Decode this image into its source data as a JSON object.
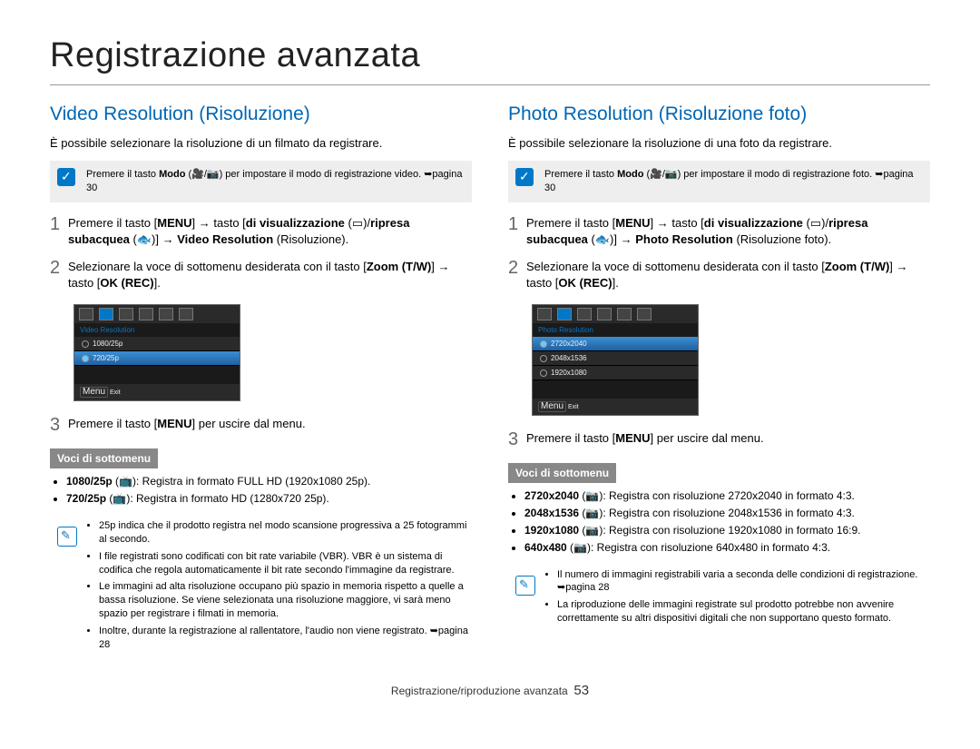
{
  "page": {
    "title": "Registrazione avanzata",
    "footer_text": "Registrazione/riproduzione avanzata",
    "page_number": "53"
  },
  "left": {
    "heading": "Video Resolution (Risoluzione)",
    "lead": "È possibile selezionare la risoluzione di un filmato da registrare.",
    "note_before": "Premere il tasto ",
    "note_bold": "Modo",
    "note_after": " (🎥/📷) per impostare il modo di registrazione video. ➥pagina 30",
    "step1_a": "Premere il tasto [",
    "step1_menu": "MENU",
    "step1_b": "] → tasto [",
    "step1_disp": "di visualizzazione",
    "step1_c": " (▭)/",
    "step1_d": "ripresa subacquea",
    "step1_e": " (🐟)] → ",
    "step1_res": "Video Resolution",
    "step1_f": " (Risoluzione).",
    "step2_a": "Selezionare la voce di sottomenu desiderata con il tasto [",
    "step2_zoom": "Zoom (T/W)",
    "step2_b": "] → tasto [",
    "step2_ok": "OK (REC)",
    "step2_c": "].",
    "step3_a": "Premere il tasto [",
    "step3_menu": "MENU",
    "step3_b": "] per uscire dal menu.",
    "screenshot": {
      "title": "Video Resolution",
      "items": [
        "1080/25p",
        "720/25p"
      ],
      "exit": "Exit"
    },
    "subhead": "Voci di sottomenu",
    "sub_items": [
      {
        "bold": "1080/25p",
        "text": " (📺): Registra in formato FULL HD (1920x1080 25p)."
      },
      {
        "bold": "720/25p",
        "text": " (📺): Registra in formato HD (1280x720 25p)."
      }
    ],
    "info": [
      "25p indica che il prodotto registra nel modo scansione progressiva a 25 fotogrammi al secondo.",
      "I file registrati sono codificati con bit rate variabile (VBR). VBR è un sistema di codifica che regola automaticamente il bit rate secondo l'immagine da registrare.",
      "Le immagini ad alta risoluzione occupano più spazio in memoria rispetto a quelle a bassa risoluzione. Se viene selezionata una risoluzione maggiore, vi sarà meno spazio per registrare i filmati in memoria.",
      "Inoltre, durante la registrazione al rallentatore, l'audio non viene registrato. ➥pagina 28"
    ]
  },
  "right": {
    "heading": "Photo Resolution (Risoluzione foto)",
    "lead": "È possibile selezionare la risoluzione di una foto da registrare.",
    "note_before": "Premere il tasto ",
    "note_bold": "Modo",
    "note_after": " (🎥/📷) per impostare il modo di registrazione foto. ➥pagina 30",
    "step1_a": "Premere il tasto [",
    "step1_menu": "MENU",
    "step1_b": "] → tasto [",
    "step1_disp": "di visualizzazione",
    "step1_c": " (▭)/",
    "step1_d": "ripresa subacquea",
    "step1_e": " (🐟)] → ",
    "step1_res": "Photo Resolution",
    "step1_f": " (Risoluzione foto).",
    "step2_a": "Selezionare la voce di sottomenu desiderata con il tasto [",
    "step2_zoom": "Zoom (T/W)",
    "step2_b": "] → tasto [",
    "step2_ok": "OK (REC)",
    "step2_c": "].",
    "step3_a": "Premere il tasto [",
    "step3_menu": "MENU",
    "step3_b": "] per uscire dal menu.",
    "screenshot": {
      "title": "Photo Resolution",
      "items": [
        "2720x2040",
        "2048x1536",
        "1920x1080"
      ],
      "exit": "Exit"
    },
    "subhead": "Voci di sottomenu",
    "sub_items": [
      {
        "bold": "2720x2040",
        "text": " (📷): Registra con risoluzione 2720x2040 in formato 4:3."
      },
      {
        "bold": "2048x1536",
        "text": " (📷): Registra con risoluzione 2048x1536 in formato 4:3."
      },
      {
        "bold": "1920x1080",
        "text": " (📷): Registra con risoluzione 1920x1080 in formato 16:9."
      },
      {
        "bold": "640x480",
        "text": " (📷): Registra con risoluzione 640x480 in formato 4:3."
      }
    ],
    "info": [
      "Il numero di immagini registrabili varia a seconda delle condizioni di registrazione. ➥pagina 28",
      "La riproduzione delle immagini registrate sul prodotto potrebbe non avvenire correttamente su altri dispositivi digitali che non supportano questo formato."
    ]
  }
}
